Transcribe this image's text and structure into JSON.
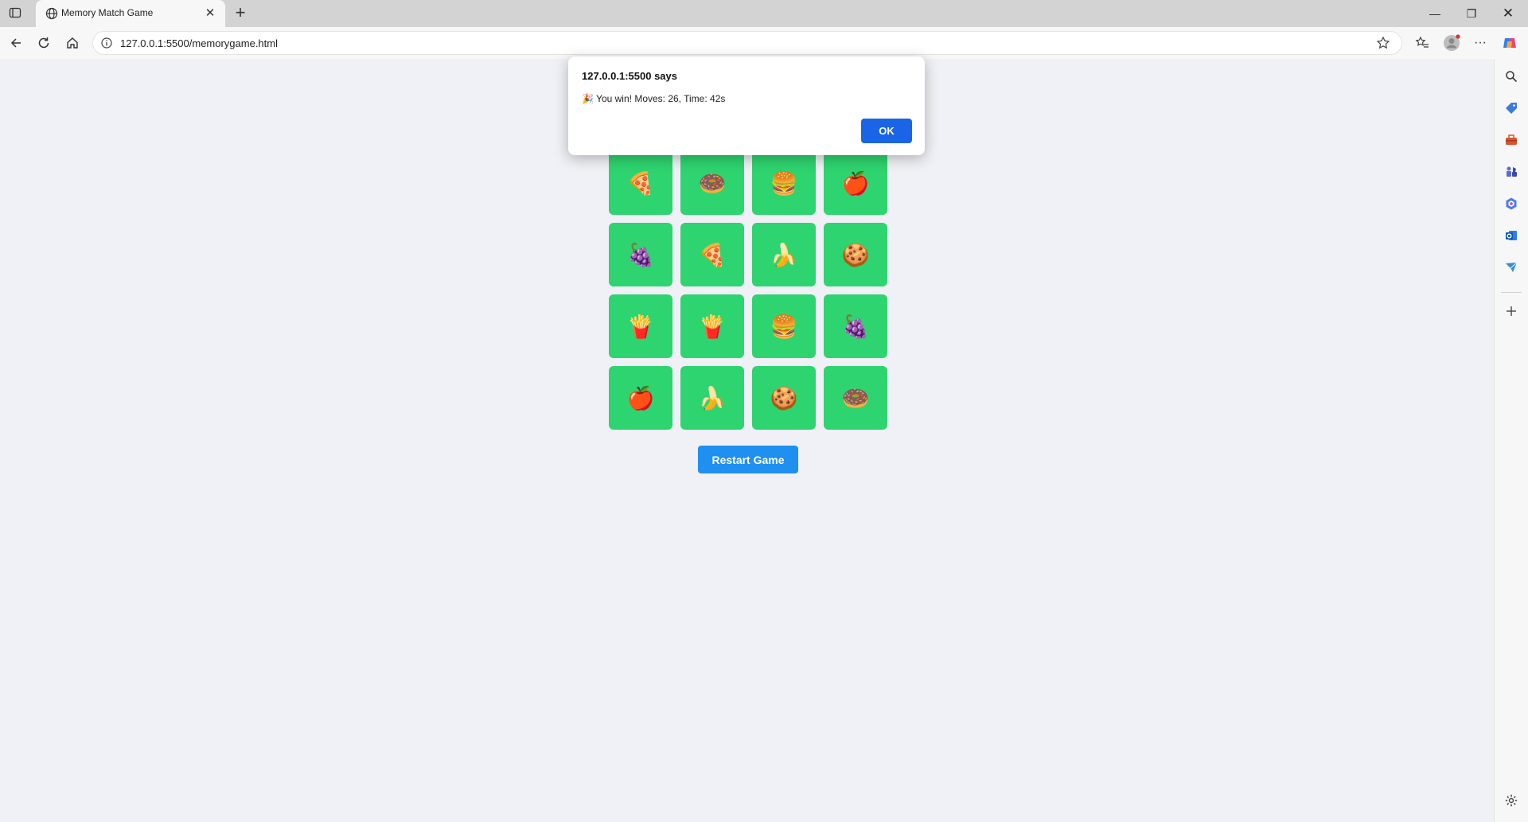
{
  "browser": {
    "tab_title": "Memory Match Game",
    "tab_close": "✕",
    "new_tab": "+",
    "url": "127.0.0.1:5500/memorygame.html",
    "window_controls": {
      "minimize": "—",
      "restore": "❐",
      "close": "✕"
    }
  },
  "game": {
    "cards": [
      "🍕",
      "🍩",
      "🍔",
      "🍎",
      "🍇",
      "🍕",
      "🍌",
      "🍪",
      "🍟",
      "🍟",
      "🍔",
      "🍇",
      "🍎",
      "🍌",
      "🍪",
      "🍩"
    ],
    "restart_label": "Restart Game"
  },
  "dialog": {
    "title": "127.0.0.1:5500 says",
    "message": "🎉 You win! Moves: 26, Time: 42s",
    "ok_label": "OK"
  },
  "colors": {
    "card": "#2ed46f",
    "restart_button": "#1f8ff0",
    "ok_button": "#1a64e6",
    "page_background": "#f0f1f6"
  }
}
